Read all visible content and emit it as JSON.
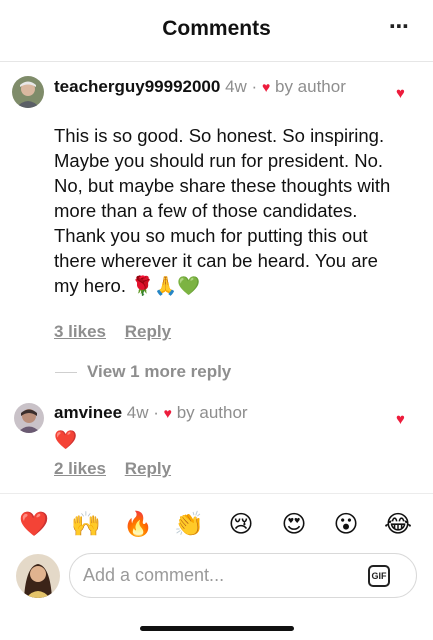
{
  "header": {
    "title": "Comments",
    "more_icon": "⋯"
  },
  "comments": [
    {
      "username": "teacherguy99992000",
      "time": "4w",
      "separator": "·",
      "heart": "♥",
      "liked_by": "by author",
      "text": "This is so good. So honest. So inspiring. Maybe you should run for president. No. No, but maybe share these thoughts with more than a few of those candidates. Thank you so much for putting this out there wherever it can be heard. You are my hero. 🌹🙏💚",
      "likes": "3 likes",
      "reply": "Reply",
      "like_button": "♥"
    },
    {
      "username": "amvinee",
      "time": "4w",
      "separator": "·",
      "heart": "♥",
      "liked_by": "by author",
      "text": "❤️",
      "likes": "2 likes",
      "reply": "Reply",
      "like_button": "♥"
    }
  ],
  "view_replies": "View 1 more reply",
  "emoji_bar": [
    "❤️",
    "🙌",
    "🔥",
    "👏",
    "😢",
    "😍",
    "😮",
    "😂"
  ],
  "composer": {
    "placeholder": "Add a comment...",
    "gif_label": "GIF"
  },
  "colors": {
    "accent_red": "#ed1c3c",
    "muted_text": "#8e8e8e"
  }
}
